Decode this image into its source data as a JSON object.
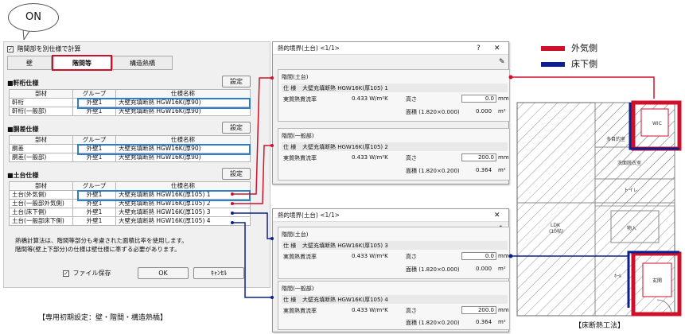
{
  "callout": "ON",
  "panel": {
    "checkbox_label": "階間部を別仕様で計算",
    "tabs": [
      "壁",
      "階間等",
      "構造熱橋"
    ],
    "settings_label": "設定",
    "headers": {
      "part": "部材",
      "group": "グループ",
      "spec": "仕様名称"
    },
    "sections": [
      {
        "title": "■軒桁仕様",
        "rows": [
          {
            "part": "軒桁",
            "group": "外壁1",
            "spec": "大壁充填断熱 HGW16K(厚90)"
          },
          {
            "part": "軒桁(一般部)",
            "group": "外壁1",
            "spec": "大壁充填断熱 HGW16K(厚90)"
          }
        ]
      },
      {
        "title": "■胴差仕様",
        "rows": [
          {
            "part": "胴差",
            "group": "外壁1",
            "spec": "大壁充填断熱 HGW16K(厚90)"
          },
          {
            "part": "胴差(一般部)",
            "group": "外壁1",
            "spec": "大壁充填断熱 HGW16K(厚90)"
          }
        ]
      },
      {
        "title": "■土台仕様",
        "rows": [
          {
            "part": "土台(外気側)",
            "group": "外壁1",
            "spec": "大壁充填断熱 HGW16K(厚105) 1"
          },
          {
            "part": "土台(一般部外気側)",
            "group": "外壁1",
            "spec": "大壁充填断熱 HGW16K(厚105) 2"
          },
          {
            "part": "土台(床下側)",
            "group": "外壁1",
            "spec": "大壁充填断熱 HGW16K(厚105) 3"
          },
          {
            "part": "土台(一般部床下側)",
            "group": "外壁1",
            "spec": "大壁充填断熱 HGW16K(厚105) 4"
          }
        ]
      }
    ],
    "note_line1": "熱橋計算法は、階間等部分も考慮された面積比率を使用します。",
    "note_line2": "階間等(壁上下部分)の仕様は壁仕様に準ずる必要があります。",
    "save_file_label": "ファイル保存",
    "ok_label": "OK",
    "cancel_label": "ｷｬﾝｾﾙ"
  },
  "dialog_top": {
    "title": "熱的境界(土台) <1/1>",
    "groups": [
      {
        "header": "階間(土台)",
        "spec_label": "仕 様",
        "spec": "大壁充填断熱 HGW16K(厚105) 1",
        "rate_label": "実質熱貫流率",
        "rate": "0.433 W/m²K",
        "height_label": "高さ",
        "height": "0.0",
        "height_unit": "mm",
        "area_label": "面積 (1.820×0.000)",
        "area": "0.000",
        "area_unit": "m²"
      },
      {
        "header": "階間(一般部)",
        "spec_label": "仕 様",
        "spec": "大壁充填断熱 HGW16K(厚105) 2",
        "rate_label": "実質熱貫流率",
        "rate": "0.433 W/m²K",
        "height_label": "高さ",
        "height": "200.0",
        "height_unit": "mm",
        "area_label": "面積 (1.820×0.200)",
        "area": "0.364",
        "area_unit": "m²"
      }
    ]
  },
  "dialog_bottom": {
    "title": "熱的境界(土台) <1/1>",
    "groups": [
      {
        "header": "階間(土台)",
        "spec_label": "仕 様",
        "spec": "大壁充填断熱 HGW16K(厚105) 3",
        "rate_label": "実質熱貫流率",
        "rate": "0.433 W/m²K",
        "height_label": "高さ",
        "height": "0.0",
        "height_unit": "mm",
        "area_label": "面積 (1.820×0.000)",
        "area": "0.000",
        "area_unit": "m²"
      },
      {
        "header": "階間(一般部)",
        "spec_label": "仕 様",
        "spec": "大壁充填断熱 HGW16K(厚105) 4",
        "rate_label": "実質熱貫流率",
        "rate": "0.433 W/m²K",
        "height_label": "高さ",
        "height": "200.0",
        "height_unit": "mm",
        "area_label": "面積 (1.820×0.200)",
        "area": "0.364",
        "area_unit": "m²"
      }
    ]
  },
  "legend": [
    {
      "label": "外気側",
      "color": "#d0102a"
    },
    {
      "label": "床下側",
      "color": "#0b1f8f"
    }
  ],
  "plan_labels": [
    "WIC",
    "多目的室",
    "洗面脱衣室",
    "トイレ",
    "LDK\n(10帖)",
    "物入",
    "玄関",
    "ﾎｰﾙ"
  ],
  "caption_left": "【専用初期設定：壁・階間・構造熱橋】",
  "caption_right": "【床断熱工法】",
  "colors": {
    "red": "#d0102a",
    "blue": "#0b1f8f",
    "highlight": "#2a7fd0"
  }
}
